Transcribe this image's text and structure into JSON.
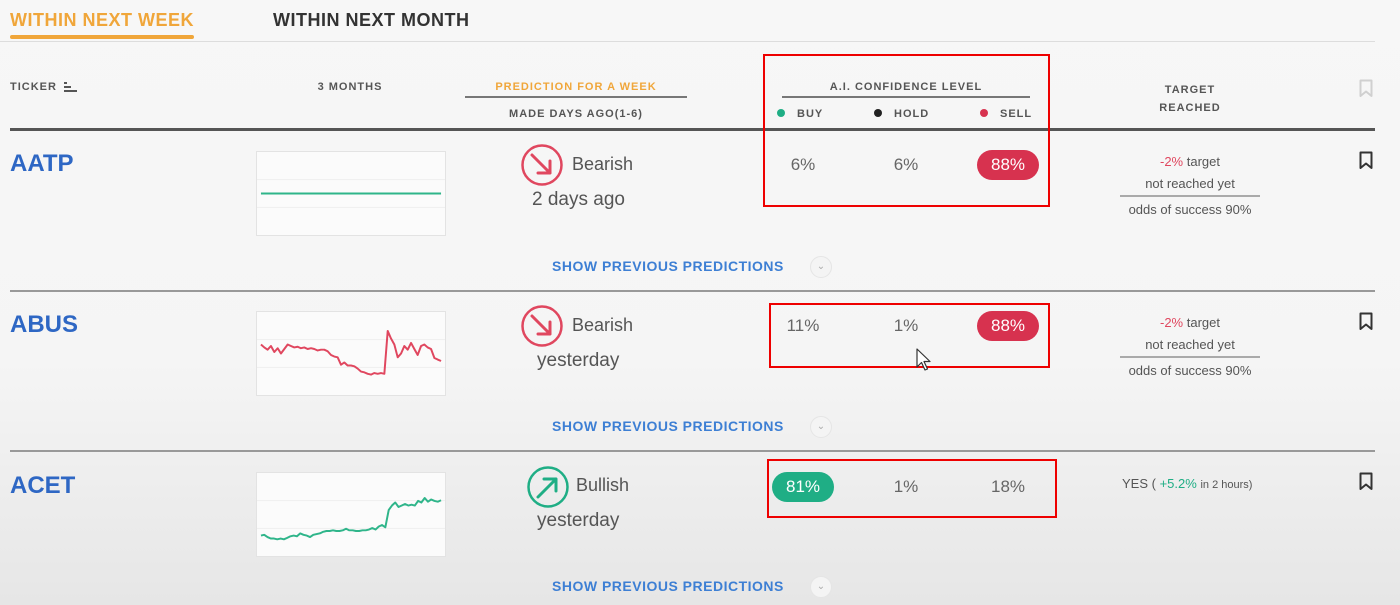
{
  "tabs": [
    {
      "label": "WITHIN NEXT WEEK",
      "active": true
    },
    {
      "label": "WITHIN NEXT MONTH",
      "active": false
    }
  ],
  "header": {
    "ticker": "TICKER",
    "three_months": "3 MONTHS",
    "prediction_for": "PREDICTION FOR A WEEK",
    "made_days_ago": "MADE DAYS AGO(1-6)",
    "confidence": "A.I. CONFIDENCE LEVEL",
    "legend": [
      {
        "label": "BUY",
        "color": "#1fae85"
      },
      {
        "label": "HOLD",
        "color": "#222222"
      },
      {
        "label": "SELL",
        "color": "#d7324f"
      }
    ],
    "target_line1": "TARGET",
    "target_line2": "REACHED"
  },
  "colors": {
    "accent": "#f0a63a",
    "ticker": "#2e67c4",
    "bearish": "#e0475f",
    "bullish": "#1fae85",
    "highlight_box": "#ee0000"
  },
  "rows": [
    {
      "ticker": "AATP",
      "sparkline": {
        "color": "#2fb58a",
        "values": [
          50,
          50,
          50,
          50,
          50,
          50,
          50,
          50,
          50,
          50
        ]
      },
      "prediction": "Bearish",
      "direction": "down",
      "when": "2 days ago",
      "buy": "6%",
      "hold": "6%",
      "sell": "88%",
      "highlight": "sell",
      "target_pct": "-2%",
      "target_word": "target",
      "target_status": "not reached yet",
      "odds": "odds of success 90%",
      "show_previous": "SHOW PREVIOUS PREDICTIONS"
    },
    {
      "ticker": "ABUS",
      "sparkline": {
        "color": "#e0475f",
        "values": [
          62,
          58,
          55,
          60,
          52,
          57,
          50,
          56,
          62,
          60,
          58,
          59,
          57,
          58,
          56,
          57,
          56,
          54,
          55,
          55,
          53,
          48,
          46,
          45,
          35,
          38,
          34,
          34,
          33,
          30,
          26,
          25,
          23,
          22,
          24,
          23,
          24,
          23,
          80,
          70,
          62,
          45,
          50,
          60,
          55,
          64,
          56,
          48,
          60,
          62,
          58,
          56,
          44,
          42,
          40
        ]
      },
      "prediction": "Bearish",
      "direction": "down",
      "when": "yesterday",
      "buy": "11%",
      "hold": "1%",
      "sell": "88%",
      "highlight": "sell",
      "target_pct": "-2%",
      "target_word": "target",
      "target_status": "not reached yet",
      "odds": "odds of success 90%",
      "show_previous": "SHOW PREVIOUS PREDICTIONS"
    },
    {
      "ticker": "ACET",
      "sparkline": {
        "color": "#2fb58a",
        "values": [
          22,
          23,
          20,
          18,
          18,
          17,
          18,
          17,
          19,
          21,
          22,
          21,
          25,
          23,
          22,
          20,
          23,
          24,
          25,
          27,
          28,
          28,
          29,
          28,
          28,
          29,
          31,
          29,
          29,
          28,
          28,
          29,
          29,
          30,
          32,
          30,
          34,
          36,
          33,
          56,
          62,
          66,
          60,
          62,
          64,
          62,
          63,
          62,
          68,
          66,
          72,
          67,
          70,
          68,
          67,
          69
        ]
      },
      "prediction": "Bullish",
      "direction": "up",
      "when": "yesterday",
      "buy": "81%",
      "hold": "1%",
      "sell": "18%",
      "highlight": "buy",
      "result_prefix": "YES (",
      "result_pct": "+5.2%",
      "result_suffix": "in 2 hours)",
      "show_previous": "SHOW PREVIOUS PREDICTIONS"
    }
  ]
}
